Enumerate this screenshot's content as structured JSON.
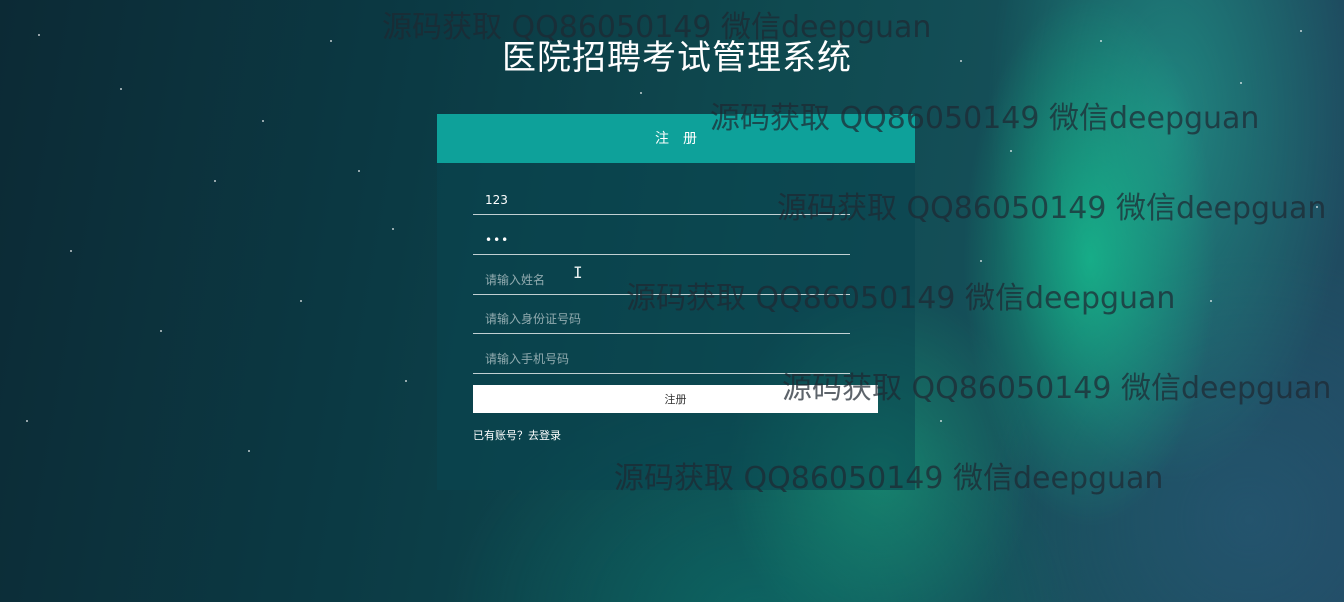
{
  "page": {
    "title": "医院招聘考试管理系统"
  },
  "register_form": {
    "header": "注册",
    "fields": {
      "username": {
        "value": "123",
        "placeholder": ""
      },
      "password": {
        "value": "123",
        "placeholder": ""
      },
      "name": {
        "value": "",
        "placeholder": "请输入姓名"
      },
      "id_number": {
        "value": "",
        "placeholder": "请输入身份证号码"
      },
      "phone": {
        "value": "",
        "placeholder": "请输入手机号码"
      }
    },
    "submit_label": "注册",
    "login_link": "已有账号？去登录"
  },
  "watermarks": [
    "源码获取 QQ86050149 微信deepguan",
    "源码获取 QQ86050149 微信deepguan",
    "源码获取 QQ86050149 微信deepguan",
    "源码获取 QQ86050149 微信deepguan",
    "源码获取 QQ86050149 微信deepguan",
    "源码获取 QQ86050149 微信deepguan"
  ],
  "colors": {
    "header_bg": "#0ea19a",
    "panel_bg": "rgba(10,70,80,0.55)",
    "button_bg": "#ffffff",
    "text": "#ffffff"
  },
  "icons": {
    "cursor": "text-cursor-icon"
  }
}
